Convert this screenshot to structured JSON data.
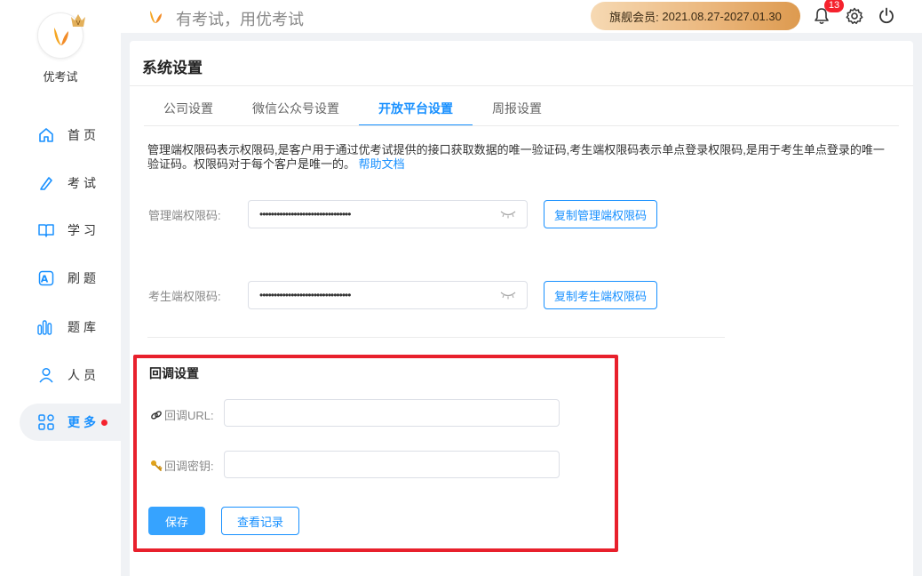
{
  "app": {
    "name": "优考试",
    "slogan": "有考试，用优考试"
  },
  "vip": {
    "label": "旗舰会员:",
    "period": "2021.08.27-2027.01.30"
  },
  "notifications": {
    "count": "13"
  },
  "sidebar": {
    "items": [
      {
        "label": "首页",
        "icon": "home-icon"
      },
      {
        "label": "考试",
        "icon": "exam-icon"
      },
      {
        "label": "学习",
        "icon": "book-icon"
      },
      {
        "label": "刷题",
        "icon": "practice-icon"
      },
      {
        "label": "题库",
        "icon": "bank-icon"
      },
      {
        "label": "人员",
        "icon": "person-icon"
      },
      {
        "label": "更多",
        "icon": "grid-icon",
        "active": true
      }
    ]
  },
  "page": {
    "title": "系统设置",
    "tabs": [
      {
        "label": "公司设置"
      },
      {
        "label": "微信公众号设置"
      },
      {
        "label": "开放平台设置",
        "active": true
      },
      {
        "label": "周报设置"
      }
    ],
    "description": "管理端权限码表示权限码,是客户用于通过优考试提供的接口获取数据的唯一验证码,考生端权限码表示单点登录权限码,是用于考生单点登录的唯一验证码。权限码对于每个客户是唯一的。",
    "help_link": "帮助文档",
    "admin_code": {
      "label": "管理端权限码:",
      "value": "••••••••••••••••••••••••••••••••",
      "copy_label": "复制管理端权限码"
    },
    "student_code": {
      "label": "考生端权限码:",
      "value": "••••••••••••••••••••••••••••••••",
      "copy_label": "复制考生端权限码"
    },
    "callback": {
      "title": "回调设置",
      "url_label": "回调URL:",
      "url_value": "",
      "secret_label": "回调密钥:",
      "secret_value": "",
      "save_label": "保存",
      "log_label": "查看记录"
    }
  },
  "colors": {
    "primary": "#1890ff",
    "highlight_box": "#e8202c",
    "badge": "#f5222d"
  }
}
